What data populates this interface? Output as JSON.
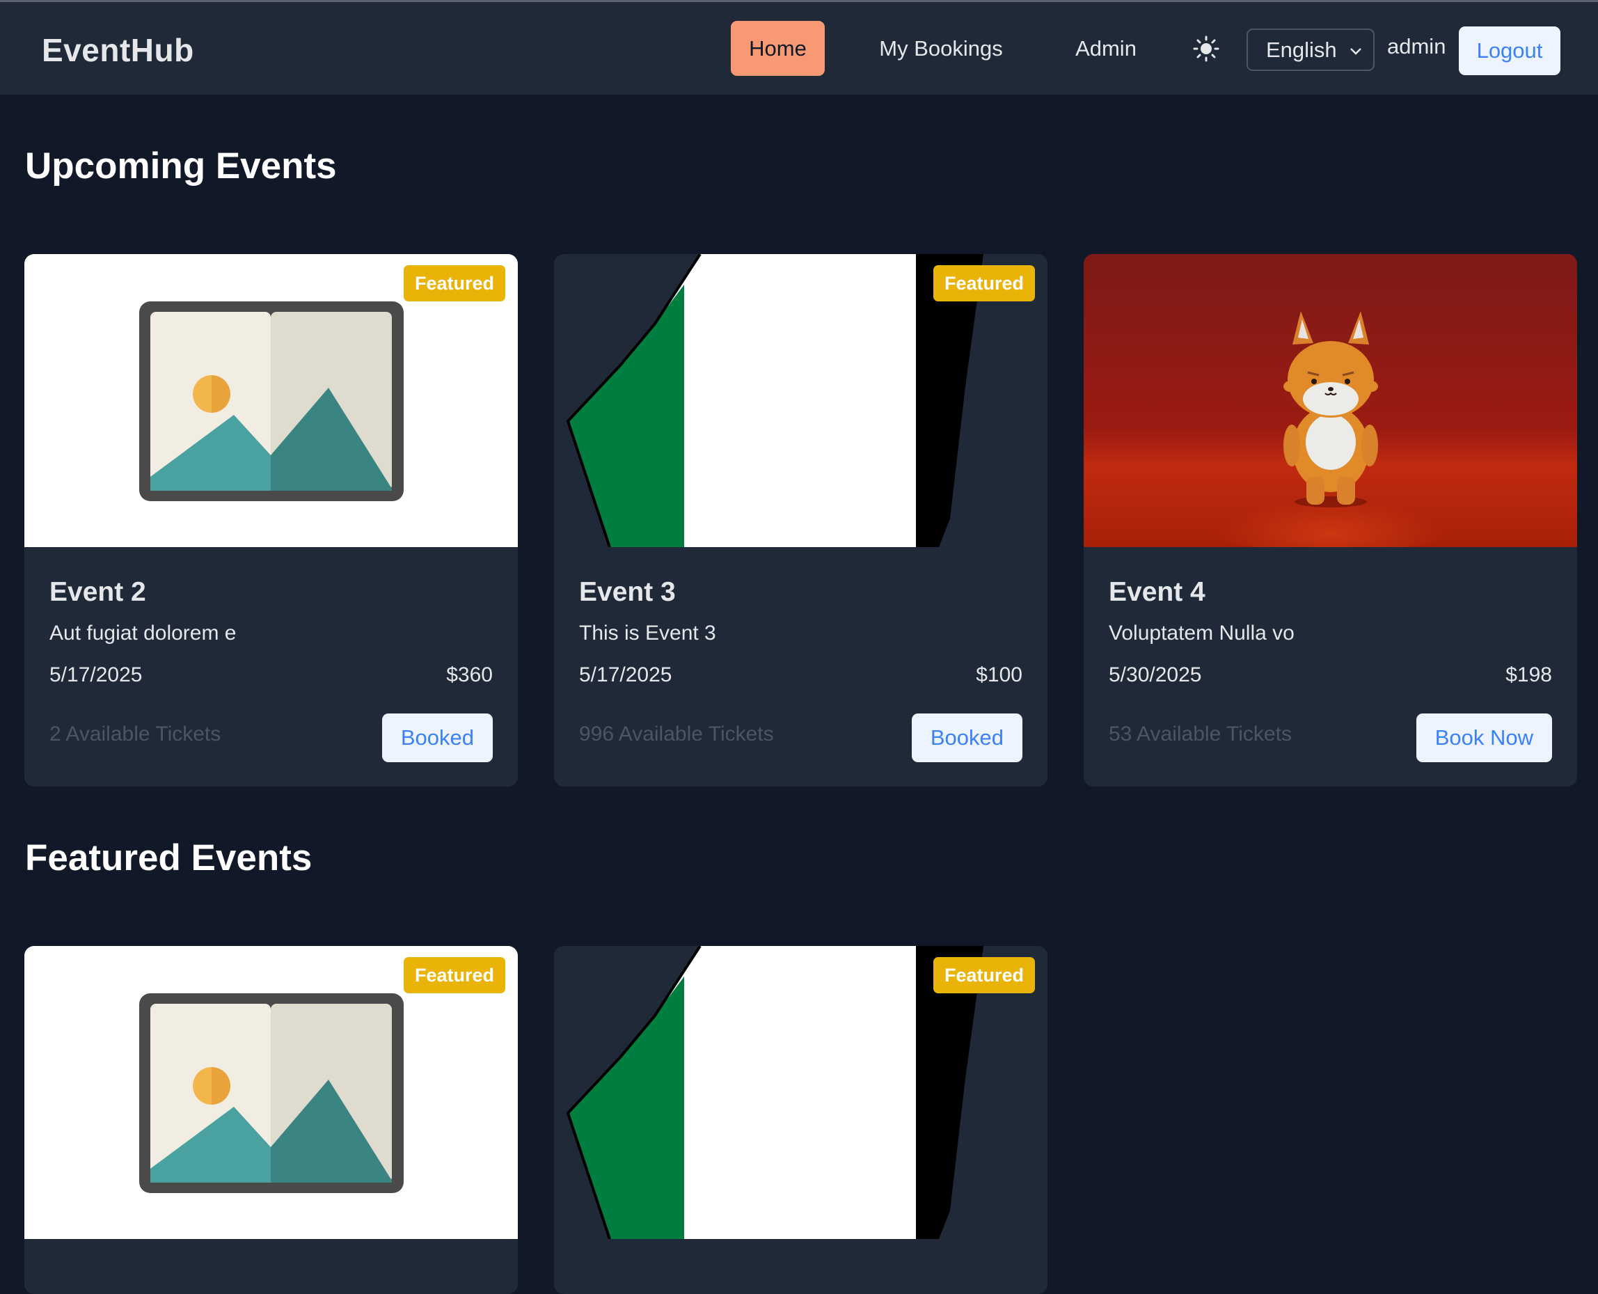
{
  "nav": {
    "brand": "EventHub",
    "home": "Home",
    "my_bookings": "My Bookings",
    "admin": "Admin",
    "language": "English",
    "username": "admin",
    "logout": "Logout",
    "active": "Home",
    "active_color": "#f79a74"
  },
  "sections": {
    "upcoming": "Upcoming Events",
    "featured": "Featured Events"
  },
  "upcoming": [
    {
      "badge": "Featured",
      "title": "Event 2",
      "description": "Aut fugiat dolorem e",
      "date": "5/17/2025",
      "price": "$360",
      "tickets": "2 Available Tickets",
      "action": "Booked",
      "image": "image-placeholder-icon"
    },
    {
      "badge": "Featured",
      "title": "Event 3",
      "description": "This is Event 3",
      "date": "5/17/2025",
      "price": "$100",
      "tickets": "996 Available Tickets",
      "action": "Booked",
      "image": "flag-image"
    },
    {
      "title": "Event 4",
      "description": "Voluptatem Nulla vo",
      "date": "5/30/2025",
      "price": "$198",
      "tickets": "53 Available Tickets",
      "action": "Book Now",
      "image": "fox-character-image"
    }
  ],
  "featured": [
    {
      "badge": "Featured",
      "image": "image-placeholder-icon"
    },
    {
      "badge": "Featured",
      "image": "flag-image"
    }
  ],
  "colors": {
    "page_bg": "#111827",
    "surface": "#1f2937",
    "badge": "#eab308",
    "button_bg": "#eef4ff",
    "button_text": "#3b82f6"
  }
}
